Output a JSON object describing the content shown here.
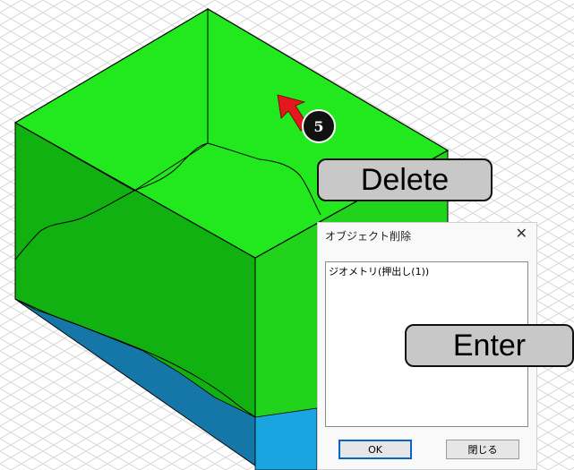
{
  "annotations": {
    "step_number": "5",
    "delete_key_label": "Delete",
    "enter_key_label": "Enter"
  },
  "dialog": {
    "title": "オブジェクト削除",
    "close_glyph": "✕",
    "list_items": [
      "ジオメトリ(押出し(1))"
    ],
    "ok_label": "OK",
    "close_label": "閉じる"
  },
  "colors": {
    "top_face": "#22e81e",
    "left_face": "#11b111",
    "right_face": "#22d31c",
    "water_left": "#1576a8",
    "water_right": "#1aa4e0",
    "arrow": "#e4181c"
  }
}
